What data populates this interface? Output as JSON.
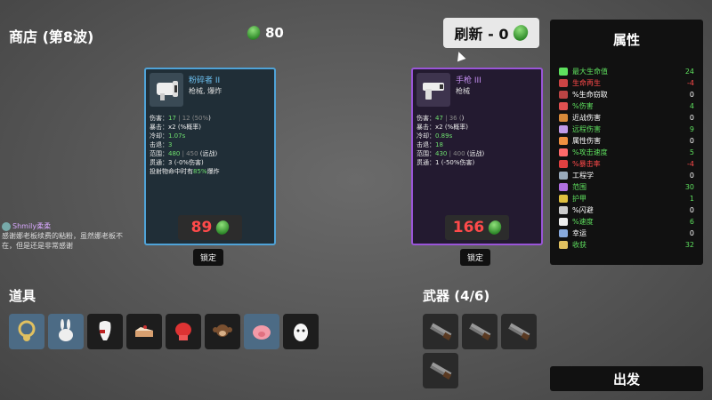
{
  "header": {
    "title": "商店 (第8波)",
    "currency": "80",
    "reroll_label": "刷新 - 0"
  },
  "cards": [
    {
      "name": "粉碎者 II",
      "tags": "枪械, 爆炸",
      "stats": [
        {
          "label": "伤害：",
          "value": "17",
          "extra": " | 12 (50%",
          "tail": ")"
        },
        {
          "label": "暴击：",
          "value": "x2",
          "extra": " (",
          "tail": "%概率)"
        },
        {
          "label": "冷却：",
          "value": "1.07s",
          "extra": "",
          "tail": ""
        },
        {
          "label": "击退：",
          "value": "3",
          "extra": "",
          "tail": ""
        },
        {
          "label": "范围：",
          "value": "480",
          "extra": " | 450",
          "tail": " (远战)"
        },
        {
          "label": "贯通：",
          "value": "3",
          "extra": "",
          "tail": " (-0%伤害)"
        }
      ],
      "special": "投射物命中时有",
      "special_value": "85%",
      "special_tail": "爆炸",
      "price": "89",
      "lock_label": "锁定"
    },
    {
      "name": "手枪 III",
      "tags": "枪械",
      "stats": [
        {
          "label": "伤害：",
          "value": "47",
          "extra": " | 36 (",
          "tail": ")"
        },
        {
          "label": "暴击：",
          "value": "x2",
          "extra": " (",
          "tail": "%概率)"
        },
        {
          "label": "冷却：",
          "value": "0.89s",
          "extra": "",
          "tail": ""
        },
        {
          "label": "击退：",
          "value": "18",
          "extra": "",
          "tail": ""
        },
        {
          "label": "范围：",
          "value": "430",
          "extra": " | 400",
          "tail": " (远战)"
        },
        {
          "label": "贯通：",
          "value": "1",
          "extra": "",
          "tail": " (-50%伤害)"
        }
      ],
      "special": "",
      "special_value": "",
      "special_tail": "",
      "price": "166",
      "lock_label": "锁定"
    }
  ],
  "chat": {
    "user": "Shmily柔柔",
    "message": "感谢娜老板续费的粘粉，虽然娜老板不在，但是还是非常感谢"
  },
  "items": {
    "title": "道具",
    "icons": [
      "necklace-icon",
      "rabbit-icon",
      "tooth-icon",
      "cake-icon",
      "boxing-glove-icon",
      "monkey-icon",
      "pig-icon",
      "egg-icon"
    ]
  },
  "weapons": {
    "title": "武器 (4/6)",
    "count": 4
  },
  "attributes": {
    "title": "属性",
    "rows": [
      {
        "label": "最大生命值",
        "value": "24",
        "color": "#5ee05e",
        "icon": "#5ee05e"
      },
      {
        "label": "生命再生",
        "value": "-4",
        "color": "#ff4a4a",
        "icon": "#cc4444"
      },
      {
        "label": "%生命窃取",
        "value": "0",
        "color": "#ffffff",
        "icon": "#b44"
      },
      {
        "label": "%伤害",
        "value": "4",
        "color": "#5ee05e",
        "icon": "#e05050"
      },
      {
        "label": "近战伤害",
        "value": "0",
        "color": "#ffffff",
        "icon": "#d88a3a"
      },
      {
        "label": "远程伤害",
        "value": "9",
        "color": "#5ee05e",
        "icon": "#c09ae8"
      },
      {
        "label": "属性伤害",
        "value": "0",
        "color": "#ffffff",
        "icon": "#f09040"
      },
      {
        "label": "%攻击速度",
        "value": "5",
        "color": "#5ee05e",
        "icon": "#ff6a6a"
      },
      {
        "label": "%暴击率",
        "value": "-4",
        "color": "#ff4a4a",
        "icon": "#e04040"
      },
      {
        "label": "工程学",
        "value": "0",
        "color": "#ffffff",
        "icon": "#9ab"
      },
      {
        "label": "范围",
        "value": "30",
        "color": "#5ee05e",
        "icon": "#b070e0"
      },
      {
        "label": "护甲",
        "value": "1",
        "color": "#5ee05e",
        "icon": "#e0c040"
      },
      {
        "label": "%闪避",
        "value": "0",
        "color": "#ffffff",
        "icon": "#ccc"
      },
      {
        "label": "%速度",
        "value": "6",
        "color": "#5ee05e",
        "icon": "#eee"
      },
      {
        "label": "幸运",
        "value": "0",
        "color": "#ffffff",
        "icon": "#8ad"
      },
      {
        "label": "收获",
        "value": "32",
        "color": "#5ee05e",
        "icon": "#e0c060"
      }
    ]
  },
  "depart_label": "出发"
}
